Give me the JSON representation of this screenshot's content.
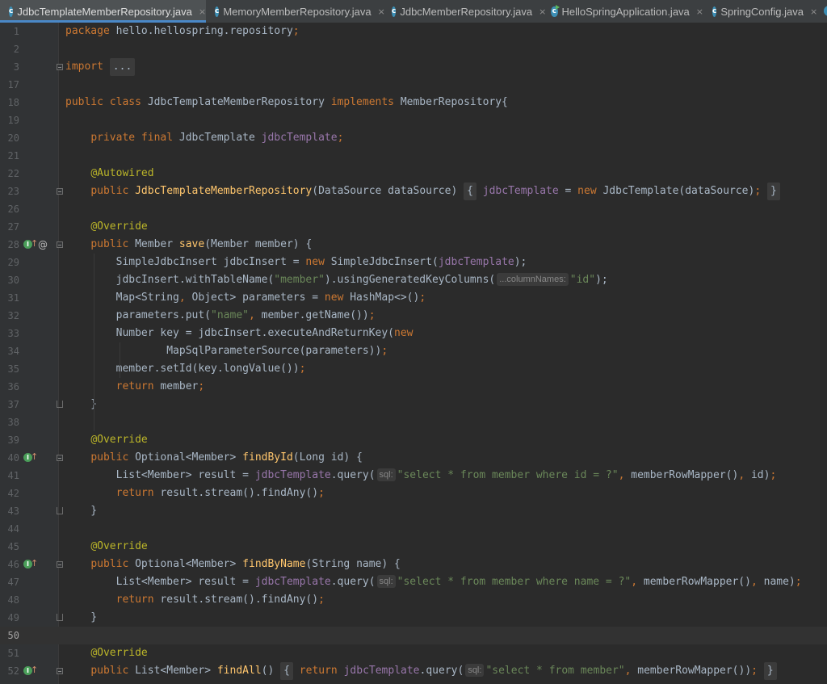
{
  "tabs": [
    {
      "label": "JdbcTemplateMemberRepository.java",
      "icon": "class-icon",
      "active": true
    },
    {
      "label": "MemoryMemberRepository.java",
      "icon": "class-icon",
      "active": false
    },
    {
      "label": "JdbcMemberRepository.java",
      "icon": "class-icon",
      "active": false
    },
    {
      "label": "HelloSpringApplication.java",
      "icon": "run-class-icon",
      "active": false
    },
    {
      "label": "SpringConfig.java",
      "icon": "class-icon",
      "active": false
    }
  ],
  "close_glyph": "×",
  "colors": {
    "background": "#2b2b2b",
    "gutter": "#313335",
    "keyword": "#cc7832",
    "annotation": "#bbb529",
    "string": "#6a8759",
    "field": "#9876aa",
    "method": "#ffc66d",
    "text": "#a9b7c6",
    "active_tab_underline": "#4a88c7"
  },
  "editor": {
    "current_line": "50",
    "lines": [
      {
        "n": "1",
        "segs": [
          [
            "kw",
            "package "
          ],
          [
            "",
            "hello.hellospring.repository"
          ],
          [
            "kw",
            ";"
          ]
        ]
      },
      {
        "n": "2",
        "segs": []
      },
      {
        "n": "3",
        "segs": [
          [
            "kw",
            "import "
          ],
          [
            "box",
            "..."
          ]
        ]
      },
      {
        "n": "17",
        "segs": []
      },
      {
        "n": "18",
        "segs": [
          [
            "kw",
            "public class "
          ],
          [
            "",
            "JdbcTemplateMemberRepository "
          ],
          [
            "kw",
            "implements "
          ],
          [
            "",
            "MemberRepository{"
          ]
        ]
      },
      {
        "n": "19",
        "segs": []
      },
      {
        "n": "20",
        "segs": [
          [
            "",
            "    "
          ],
          [
            "kw",
            "private final "
          ],
          [
            "",
            "JdbcTemplate "
          ],
          [
            "fld",
            "jdbcTemplate"
          ],
          [
            "kw",
            ";"
          ]
        ]
      },
      {
        "n": "21",
        "segs": []
      },
      {
        "n": "22",
        "segs": [
          [
            "",
            "    "
          ],
          [
            "ann",
            "@Autowired"
          ]
        ]
      },
      {
        "n": "23",
        "segs": [
          [
            "",
            "    "
          ],
          [
            "kw",
            "public "
          ],
          [
            "fn",
            "JdbcTemplateMemberRepository"
          ],
          [
            "",
            "(DataSource dataSource) "
          ],
          [
            "box",
            "{"
          ],
          [
            "",
            ""
          ],
          [
            "fld",
            " jdbcTemplate"
          ],
          [
            "",
            " = "
          ],
          [
            "kw",
            "new "
          ],
          [
            "",
            "JdbcTemplate(dataSource)"
          ],
          [
            "kw",
            "; "
          ],
          [
            "box",
            "}"
          ]
        ]
      },
      {
        "n": "26",
        "segs": []
      },
      {
        "n": "27",
        "segs": [
          [
            "",
            "    "
          ],
          [
            "ann",
            "@Override"
          ]
        ]
      },
      {
        "n": "28",
        "segs": [
          [
            "",
            "    "
          ],
          [
            "kw",
            "public "
          ],
          [
            "",
            "Member "
          ],
          [
            "fn",
            "save"
          ],
          [
            "",
            "(Member member) {"
          ]
        ]
      },
      {
        "n": "29",
        "segs": [
          [
            "",
            "        SimpleJdbcInsert jdbcInsert = "
          ],
          [
            "kw",
            "new "
          ],
          [
            "",
            "SimpleJdbcInsert("
          ],
          [
            "fld",
            "jdbcTemplate"
          ],
          [
            "",
            ");"
          ]
        ]
      },
      {
        "n": "30",
        "segs": [
          [
            "",
            "        jdbcInsert.withTableName("
          ],
          [
            "str",
            "\"member\""
          ],
          [
            "",
            ").usingGeneratedKeyColumns("
          ],
          [
            "hint",
            "...columnNames:"
          ],
          [
            "str",
            "\"id\""
          ],
          [
            "",
            ");"
          ]
        ]
      },
      {
        "n": "31",
        "segs": [
          [
            "",
            "        Map<String"
          ],
          [
            "kw",
            ", "
          ],
          [
            "",
            "Object> parameters = "
          ],
          [
            "kw",
            "new "
          ],
          [
            "",
            "HashMap<>()"
          ],
          [
            "kw",
            ";"
          ]
        ]
      },
      {
        "n": "32",
        "segs": [
          [
            "",
            "        parameters.put("
          ],
          [
            "str",
            "\"name\""
          ],
          [
            "kw",
            ", "
          ],
          [
            "",
            "member.getName())"
          ],
          [
            "kw",
            ";"
          ]
        ]
      },
      {
        "n": "33",
        "segs": [
          [
            "",
            "        Number key = jdbcInsert.executeAndReturnKey("
          ],
          [
            "kw",
            "new"
          ]
        ]
      },
      {
        "n": "34",
        "segs": [
          [
            "",
            "                MapSqlParameterSource(parameters))"
          ],
          [
            "kw",
            ";"
          ]
        ]
      },
      {
        "n": "35",
        "segs": [
          [
            "",
            "        member.setId(key.longValue())"
          ],
          [
            "kw",
            ";"
          ]
        ]
      },
      {
        "n": "36",
        "segs": [
          [
            "",
            "        "
          ],
          [
            "kw",
            "return "
          ],
          [
            "",
            "member"
          ],
          [
            "kw",
            ";"
          ]
        ]
      },
      {
        "n": "37",
        "segs": [
          [
            "",
            "    }"
          ]
        ]
      },
      {
        "n": "38",
        "segs": []
      },
      {
        "n": "39",
        "segs": [
          [
            "",
            "    "
          ],
          [
            "ann",
            "@Override"
          ]
        ]
      },
      {
        "n": "40",
        "segs": [
          [
            "",
            "    "
          ],
          [
            "kw",
            "public "
          ],
          [
            "",
            "Optional<Member> "
          ],
          [
            "fn",
            "findById"
          ],
          [
            "",
            "(Long id) {"
          ]
        ]
      },
      {
        "n": "41",
        "segs": [
          [
            "",
            "        List<Member> result = "
          ],
          [
            "fld",
            "jdbcTemplate"
          ],
          [
            "",
            ".query("
          ],
          [
            "hint",
            "sql:"
          ],
          [
            "str",
            "\"select * from member where id = ?\""
          ],
          [
            "kw",
            ", "
          ],
          [
            "",
            "memberRowMapper()"
          ],
          [
            "kw",
            ", "
          ],
          [
            "",
            "id)"
          ],
          [
            "kw",
            ";"
          ]
        ]
      },
      {
        "n": "42",
        "segs": [
          [
            "",
            "        "
          ],
          [
            "kw",
            "return "
          ],
          [
            "",
            "result.stream().findAny()"
          ],
          [
            "kw",
            ";"
          ]
        ]
      },
      {
        "n": "43",
        "segs": [
          [
            "",
            "    }"
          ]
        ]
      },
      {
        "n": "44",
        "segs": []
      },
      {
        "n": "45",
        "segs": [
          [
            "",
            "    "
          ],
          [
            "ann",
            "@Override"
          ]
        ]
      },
      {
        "n": "46",
        "segs": [
          [
            "",
            "    "
          ],
          [
            "kw",
            "public "
          ],
          [
            "",
            "Optional<Member> "
          ],
          [
            "fn",
            "findByName"
          ],
          [
            "",
            "(String name) {"
          ]
        ]
      },
      {
        "n": "47",
        "segs": [
          [
            "",
            "        List<Member> result = "
          ],
          [
            "fld",
            "jdbcTemplate"
          ],
          [
            "",
            ".query("
          ],
          [
            "hint",
            "sql:"
          ],
          [
            "str",
            "\"select * from member where name = ?\""
          ],
          [
            "kw",
            ", "
          ],
          [
            "",
            "memberRowMapper()"
          ],
          [
            "kw",
            ", "
          ],
          [
            "",
            "name)"
          ],
          [
            "kw",
            ";"
          ]
        ]
      },
      {
        "n": "48",
        "segs": [
          [
            "",
            "        "
          ],
          [
            "kw",
            "return "
          ],
          [
            "",
            "result.stream().findAny()"
          ],
          [
            "kw",
            ";"
          ]
        ]
      },
      {
        "n": "49",
        "segs": [
          [
            "",
            "    }"
          ]
        ]
      },
      {
        "n": "50",
        "segs": []
      },
      {
        "n": "51",
        "segs": [
          [
            "",
            "    "
          ],
          [
            "ann",
            "@Override"
          ]
        ]
      },
      {
        "n": "52",
        "segs": [
          [
            "",
            "    "
          ],
          [
            "kw",
            "public "
          ],
          [
            "",
            "List<Member> "
          ],
          [
            "fn",
            "findAll"
          ],
          [
            "",
            "() "
          ],
          [
            "box",
            "{"
          ],
          [
            "kw",
            " return "
          ],
          [
            "fld",
            "jdbcTemplate"
          ],
          [
            "",
            ".query("
          ],
          [
            "hint",
            "sql:"
          ],
          [
            "str",
            "\"select * from member\""
          ],
          [
            "kw",
            ", "
          ],
          [
            "",
            "memberRowMapper())"
          ],
          [
            "kw",
            "; "
          ],
          [
            "box",
            "}"
          ]
        ]
      }
    ]
  },
  "gutter_marks": {
    "fold_open": [
      "3",
      "23",
      "28",
      "40",
      "46",
      "52"
    ],
    "fold_close": [
      "37",
      "43",
      "49"
    ],
    "implements_icons": [
      "28",
      "40",
      "46",
      "52"
    ],
    "at_sign": [
      "28"
    ]
  }
}
